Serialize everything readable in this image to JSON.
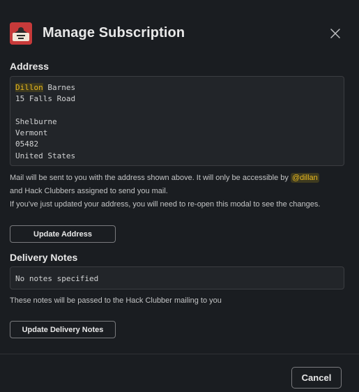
{
  "header": {
    "title": "Manage Subscription",
    "app_icon": "hack-club-flag-icon",
    "close_icon": "close-icon"
  },
  "address": {
    "label": "Address",
    "first_name": "Dillon",
    "last_name": " Barnes",
    "lines": [
      "15 Falls Road",
      "",
      "Shelburne",
      "Vermont",
      "05482",
      "United States"
    ]
  },
  "address_info": {
    "text_before_mention": "Mail will be sent to you with the address shown above. It will only be accessible by ",
    "mention": "@dillan",
    "text_after_mention": "and Hack Clubbers assigned to send you mail.",
    "reopen_note": "If you've just updated your address, you will need to re-open this modal to see the changes."
  },
  "update_address_label": "Update Address",
  "delivery_notes": {
    "label": "Delivery Notes",
    "value": "No notes specified",
    "info": "These notes will be passed to the Hack Clubber mailing to you",
    "update_label": "Update Delivery Notes"
  },
  "footer": {
    "cancel_label": "Cancel"
  },
  "colors": {
    "background": "#1a1d21",
    "highlight": "#e8b81e",
    "icon_bg": "#c73a3a"
  }
}
